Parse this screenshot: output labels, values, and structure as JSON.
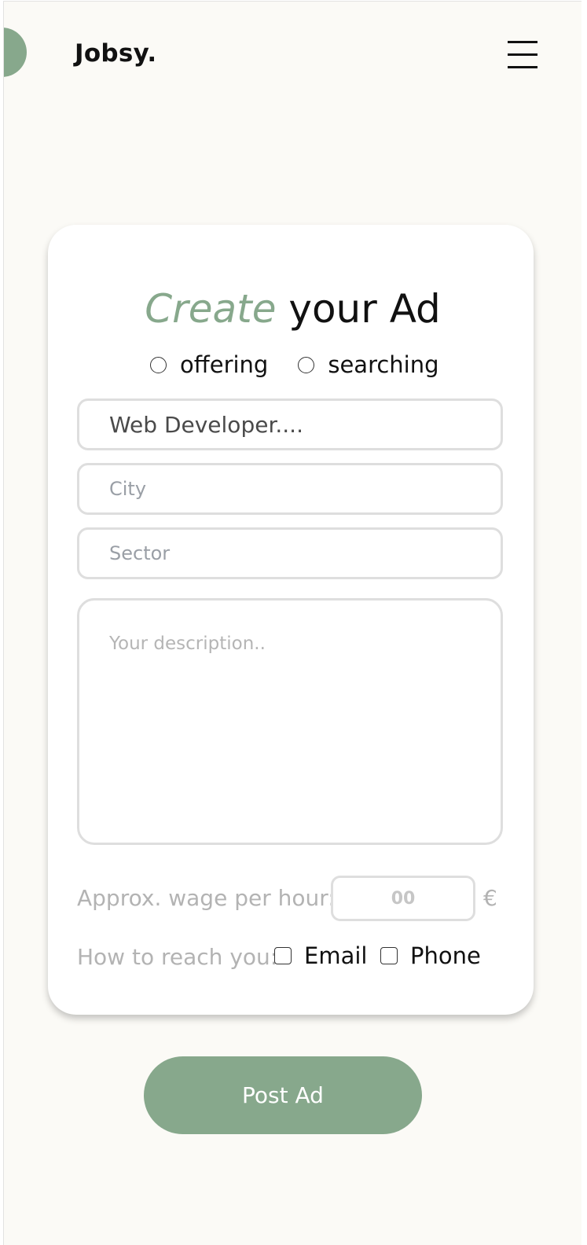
{
  "header": {
    "logo": "Jobsy.",
    "menu_icon": "hamburger-menu-icon"
  },
  "form": {
    "title_accent": "Create",
    "title_rest": " your Ad",
    "ad_type_options": [
      {
        "label": "offering",
        "selected": false
      },
      {
        "label": "searching",
        "selected": false
      }
    ],
    "job_title_placeholder": "Web Developer....",
    "city_placeholder": "City",
    "sector_placeholder": "Sector",
    "description_placeholder": "Your description..",
    "wage_label": "Approx. wage per hour:",
    "wage_placeholder": "00",
    "currency": "€",
    "reach_label": "How to reach you:",
    "reach_options": [
      {
        "label": "Email",
        "checked": false
      },
      {
        "label": "Phone",
        "checked": false
      }
    ],
    "submit_label": "Post Ad"
  },
  "colors": {
    "accent": "#87a88c",
    "background": "#fbfaf6",
    "card": "#ffffff",
    "field_border": "#dedede",
    "muted_text": "#b3b3b3"
  }
}
